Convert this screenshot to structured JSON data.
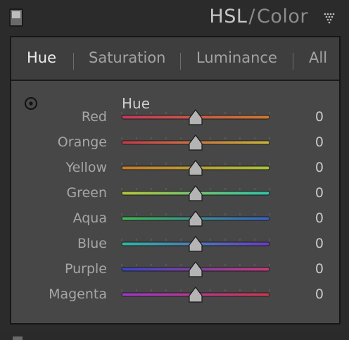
{
  "panel": {
    "title_main": "HSL",
    "title_sep": "/",
    "title_sub": "Color",
    "collapse_icon": "triangle-down-dotted-icon",
    "toggle_icon": "panel-switch-icon"
  },
  "tabs": [
    {
      "label": "Hue",
      "active": true
    },
    {
      "label": "Saturation",
      "active": false
    },
    {
      "label": "Luminance",
      "active": false
    },
    {
      "label": "All",
      "active": false
    }
  ],
  "section": {
    "label": "Hue",
    "target_icon": "target-adjustment-icon"
  },
  "sliders": [
    {
      "label": "Red",
      "value": "0",
      "position": 0.5,
      "gradient": [
        "#c2395b",
        "#cc7a2e"
      ]
    },
    {
      "label": "Orange",
      "value": "0",
      "position": 0.5,
      "gradient": [
        "#c2394a",
        "#c7b33a"
      ]
    },
    {
      "label": "Yellow",
      "value": "0",
      "position": 0.5,
      "gradient": [
        "#c5792c",
        "#a9c23a"
      ]
    },
    {
      "label": "Green",
      "value": "0",
      "position": 0.5,
      "gradient": [
        "#b4c23a",
        "#2ec2a6"
      ]
    },
    {
      "label": "Aqua",
      "value": "0",
      "position": 0.5,
      "gradient": [
        "#3dbb52",
        "#3a62c7"
      ]
    },
    {
      "label": "Blue",
      "value": "0",
      "position": 0.5,
      "gradient": [
        "#2fb6a2",
        "#6a3ac7"
      ]
    },
    {
      "label": "Purple",
      "value": "0",
      "position": 0.5,
      "gradient": [
        "#3a45c7",
        "#c73a7a"
      ]
    },
    {
      "label": "Magenta",
      "value": "0",
      "position": 0.5,
      "gradient": [
        "#9a3ac7",
        "#c73a4d"
      ]
    }
  ],
  "colors": {
    "panel_bg": "#474747",
    "tab_bar_bg": "#3e3e3e",
    "text_active": "#ededed",
    "text_inactive": "#a3a3a3"
  }
}
